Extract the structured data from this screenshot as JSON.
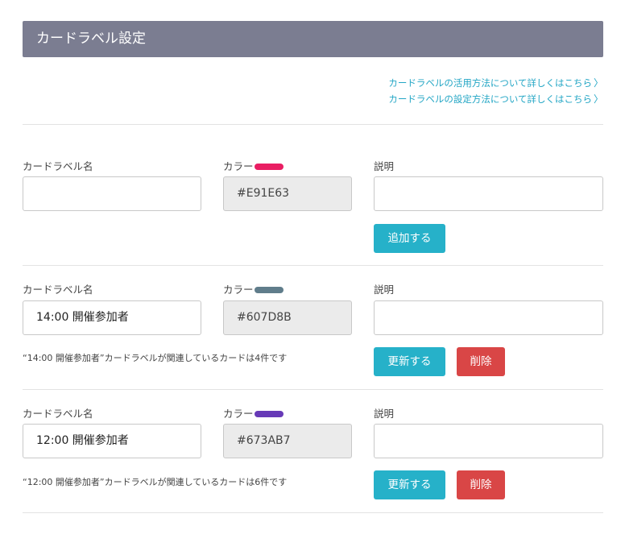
{
  "header": {
    "title": "カードラベル設定"
  },
  "help_links": [
    {
      "label": "カードラベルの活用方法について詳しくはこちら"
    },
    {
      "label": "カードラベルの設定方法について詳しくはこちら"
    }
  ],
  "chevron": "〉",
  "labels": {
    "name": "カードラベル名",
    "color": "カラー",
    "description": "説明"
  },
  "new_label": {
    "name_value": "",
    "color_value": "#E91E63",
    "color": "#E91E63",
    "description_value": "",
    "add_button": "追加する"
  },
  "rows": [
    {
      "name_value": "14:00 開催参加者",
      "color_value": "#607D8B",
      "color": "#607D8B",
      "description_value": "",
      "note": "“14:00 開催参加者”カードラベルが関連しているカードは4件です",
      "update_button": "更新する",
      "delete_button": "削除"
    },
    {
      "name_value": "12:00 開催参加者",
      "color_value": "#673AB7",
      "color": "#673AB7",
      "description_value": "",
      "note": "“12:00 開催参加者”カードラベルが関連しているカードは6件です",
      "update_button": "更新する",
      "delete_button": "削除"
    }
  ]
}
